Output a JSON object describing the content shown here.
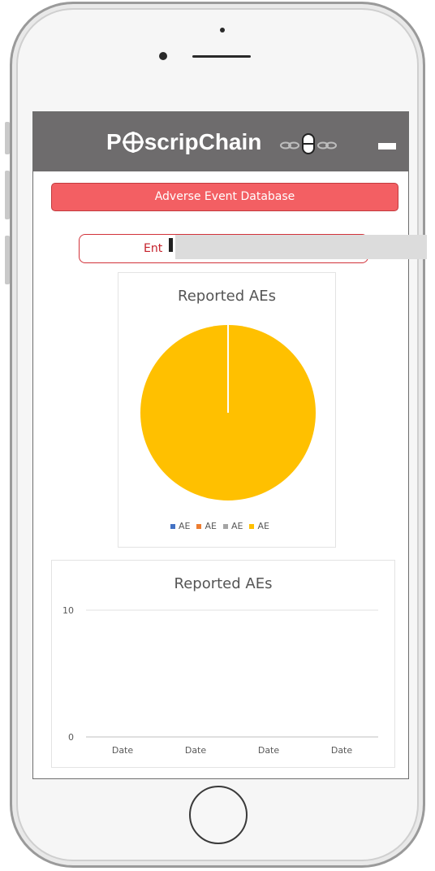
{
  "app": {
    "logo_prefix": "P",
    "logo_suffix": "scripChain",
    "menu_icon": "hamburger-icon"
  },
  "banner": {
    "label": "Adverse Event Database"
  },
  "search": {
    "value": "Ent"
  },
  "charts_text": {
    "pie_title": "Reported AEs",
    "line_title": "Reported AEs"
  },
  "chart_data": [
    {
      "type": "pie",
      "title": "Reported AEs",
      "categories": [
        "AE",
        "AE",
        "AE",
        "AE"
      ],
      "values": [
        0,
        0,
        0,
        1
      ],
      "colors": [
        "#4472c4",
        "#ed7d31",
        "#a5a5a5",
        "#ffc000"
      ],
      "legend": "bottom"
    },
    {
      "type": "line",
      "title": "Reported AEs",
      "categories": [
        "Date",
        "Date",
        "Date",
        "Date"
      ],
      "yticks": [
        0,
        10
      ],
      "ylim": [
        0,
        10
      ],
      "grid": true,
      "series": []
    }
  ]
}
